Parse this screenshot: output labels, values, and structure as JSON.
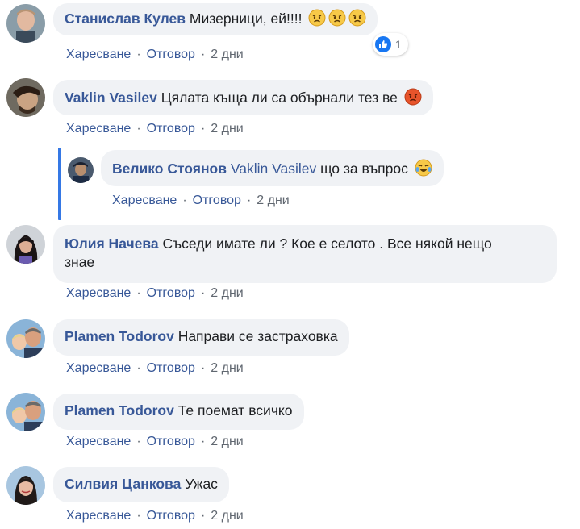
{
  "actions": {
    "like": "Харесване",
    "reply": "Отговор",
    "separator": "·"
  },
  "comments": [
    {
      "author": "Станислав Кулев",
      "text": "Мизерници, ей!!!!",
      "emojis": [
        "angry-face-icon",
        "angry-face-icon",
        "angry-face-icon"
      ],
      "time": "2 дни",
      "reaction_count": "1"
    },
    {
      "author": "Vaklin Vasilev",
      "text": "Цялата къща ли са обърнали тез ве",
      "emojis": [
        "pouting-face-icon"
      ],
      "time": "2 дни"
    },
    {
      "author": "Велико Стоянов",
      "mention": "Vaklin Vasilev",
      "text": "що за въпрос",
      "emojis": [
        "tears-of-joy-icon"
      ],
      "time": "2 дни"
    },
    {
      "author": "Юлия Начева",
      "text": "Съседи имате ли ? Кое е селото . Все някой нещо",
      "text_line2": "знае",
      "time": "2 дни"
    },
    {
      "author": "Plamen Todorov",
      "text": "Направи се застраховка",
      "time": "2 дни"
    },
    {
      "author": "Plamen Todorov",
      "text": "Те поемат всичко",
      "time": "2 дни"
    },
    {
      "author": "Силвия Цанкова",
      "text": "Ужас",
      "time": "2 дни"
    }
  ],
  "colors": {
    "link": "#385898",
    "bubble": "#f0f2f5",
    "meta": "#606770",
    "reply_line": "#3578e5",
    "like_blue": "#1877f2"
  }
}
